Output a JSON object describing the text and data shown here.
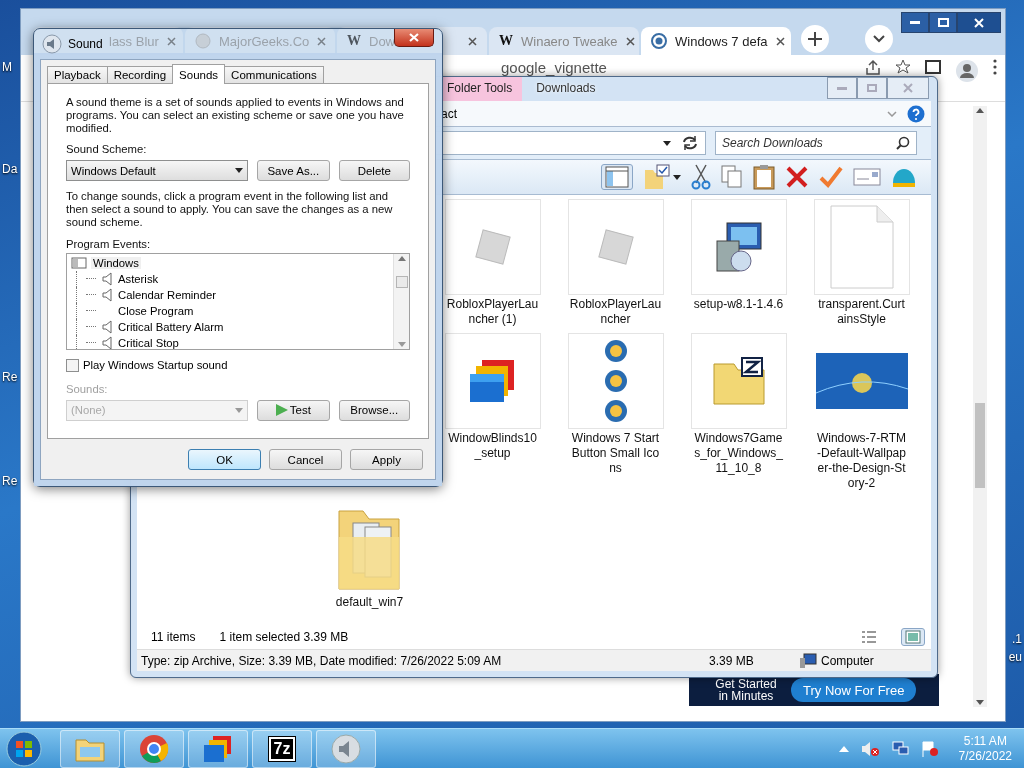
{
  "desktop": {
    "left_labels": [
      "M",
      "Da",
      "Re",
      "Re"
    ],
    "right_labels": [
      ".1",
      "eu"
    ]
  },
  "browser": {
    "tabs": [
      {
        "title": "lass Blur",
        "kind": "blank",
        "selected": false
      },
      {
        "title": "MajorGeeks.Co",
        "kind": "globe",
        "selected": false
      },
      {
        "title": "Dow",
        "kind": "letter",
        "badge": "W",
        "selected": false
      },
      {
        "title": "Winaero Tweake",
        "kind": "letter",
        "badge": "W",
        "selected": false
      },
      {
        "title": "Windows 7 defa",
        "kind": "wordpress",
        "selected": true
      }
    ],
    "address_text": "google_vignette",
    "ad": {
      "text": "Get Started in Minutes",
      "button": "Try Now For Free"
    }
  },
  "explorer": {
    "context_tab": "Folder Tools",
    "title": "Downloads",
    "ribbon_tab": "act",
    "search_placeholder": "Search Downloads",
    "rows": [
      {
        "items": [
          {
            "name": "RobloxPlayerLauncher (1)",
            "kind": "roblox"
          },
          {
            "name": "RobloxPlayerLauncher",
            "kind": "roblox"
          },
          {
            "name": "setup-w8.1-1.4.6",
            "kind": "installer"
          },
          {
            "name": "transparent.CurtainsStyle",
            "kind": "document"
          }
        ]
      },
      {
        "items": [
          {
            "name": "WindowBlinds10_setup",
            "kind": "windowblinds"
          },
          {
            "name": "Windows 7 Start Button Small Icons",
            "kind": "orbs"
          },
          {
            "name": "Windows7Games_for_Windows_11_10_8",
            "kind": "zip"
          },
          {
            "name": "Windows-7-RTM-Default-Wallpaper-the-Design-Story-2",
            "kind": "wallpaper"
          }
        ]
      },
      {
        "items": [
          {
            "name": "default_win7",
            "kind": "folder"
          }
        ]
      }
    ],
    "status": {
      "count": "11 items",
      "selection": "1 item selected  3.39 MB"
    },
    "details": {
      "info": "Type: zip Archive, Size: 3.39 MB, Date modified: 7/26/2022 5:09 AM",
      "size": "3.39 MB",
      "location": "Computer"
    }
  },
  "sound_dialog": {
    "title": "Sound",
    "tabs": [
      {
        "label": "Playback",
        "selected": false
      },
      {
        "label": "Recording",
        "selected": false
      },
      {
        "label": "Sounds",
        "selected": true
      },
      {
        "label": "Communications",
        "selected": false
      }
    ],
    "intro": "A sound theme is a set of sounds applied to events in Windows and programs.  You can select an existing scheme or save one you have modified.",
    "scheme_label": "Sound Scheme:",
    "scheme": "Windows Default",
    "save_as": "Save As...",
    "delete": "Delete",
    "help": "To change sounds, click a program event in the following list and then select a sound to apply.  You can save the changes as a new sound scheme.",
    "events_label": "Program Events:",
    "events": [
      {
        "label": "Windows",
        "children": [
          {
            "label": "Asterisk",
            "has_sound": true
          },
          {
            "label": "Calendar Reminder",
            "has_sound": true
          },
          {
            "label": "Close Program",
            "has_sound": false
          },
          {
            "label": "Critical Battery Alarm",
            "has_sound": true
          },
          {
            "label": "Critical Stop",
            "has_sound": true
          }
        ]
      }
    ],
    "startup": {
      "label": "Play Windows Startup sound",
      "checked": false
    },
    "sounds_label": "Sounds:",
    "sounds": {
      "value": "(None)",
      "disabled": true
    },
    "test": "Test",
    "browse": "Browse...",
    "buttons": [
      "OK",
      "Cancel",
      "Apply"
    ]
  },
  "taskbar": {
    "apps": [
      {
        "kind": "explorer"
      },
      {
        "kind": "chrome"
      },
      {
        "kind": "windowblinds"
      },
      {
        "kind": "sevenzip",
        "label": "7z"
      },
      {
        "kind": "sound"
      }
    ],
    "time": "5:11 AM",
    "date": "7/26/2022"
  }
}
